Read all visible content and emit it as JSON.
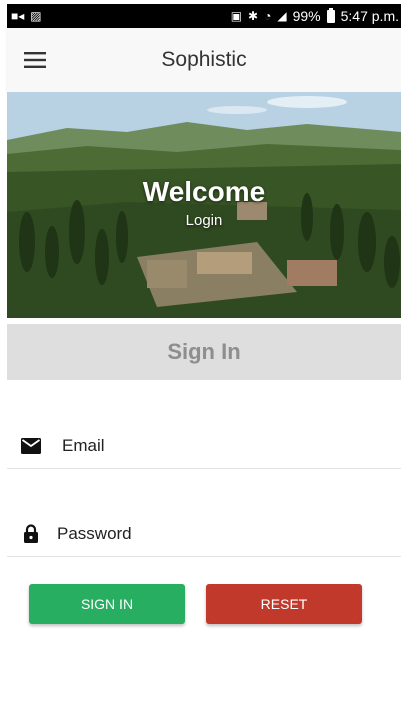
{
  "status_bar": {
    "battery": "99%",
    "time": "5:47 p.m."
  },
  "app_bar": {
    "title": "Sophistic"
  },
  "hero": {
    "title": "Welcome",
    "subtitle": "Login"
  },
  "section": {
    "label": "Sign In"
  },
  "form": {
    "email_placeholder": "Email",
    "password_placeholder": "Password"
  },
  "buttons": {
    "sign_in": "SIGN IN",
    "reset": "RESET"
  },
  "colors": {
    "sign_in_button": "#27ae60",
    "reset_button": "#c0392b",
    "section_band": "#dedede"
  }
}
